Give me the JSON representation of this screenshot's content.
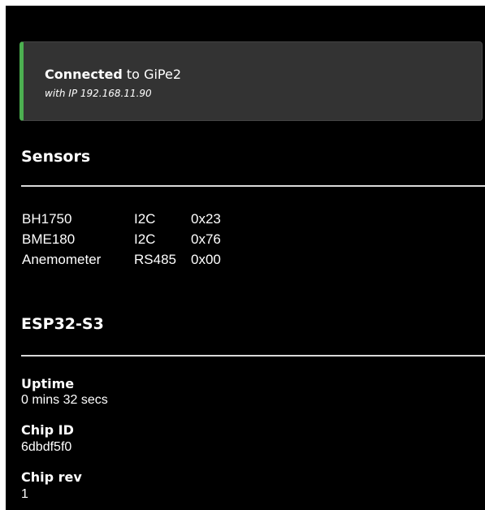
{
  "connection": {
    "status_word": "Connected",
    "connector": "to",
    "network": "GiPe2",
    "ip_line": "with IP 192.168.11.90",
    "accent_color": "#4caf50"
  },
  "sensors": {
    "heading": "Sensors",
    "rows": [
      {
        "name": "BH1750",
        "bus": "I2C",
        "address": "0x23"
      },
      {
        "name": "BME180",
        "bus": "I2C",
        "address": "0x76"
      },
      {
        "name": "Anemometer",
        "bus": "RS485",
        "address": "0x00"
      }
    ]
  },
  "device": {
    "heading": "ESP32-S3",
    "fields": [
      {
        "label": "Uptime",
        "value": "0 mins 32 secs"
      },
      {
        "label": "Chip ID",
        "value": "6dbdf5f0"
      },
      {
        "label": "Chip rev",
        "value": "1"
      }
    ]
  }
}
